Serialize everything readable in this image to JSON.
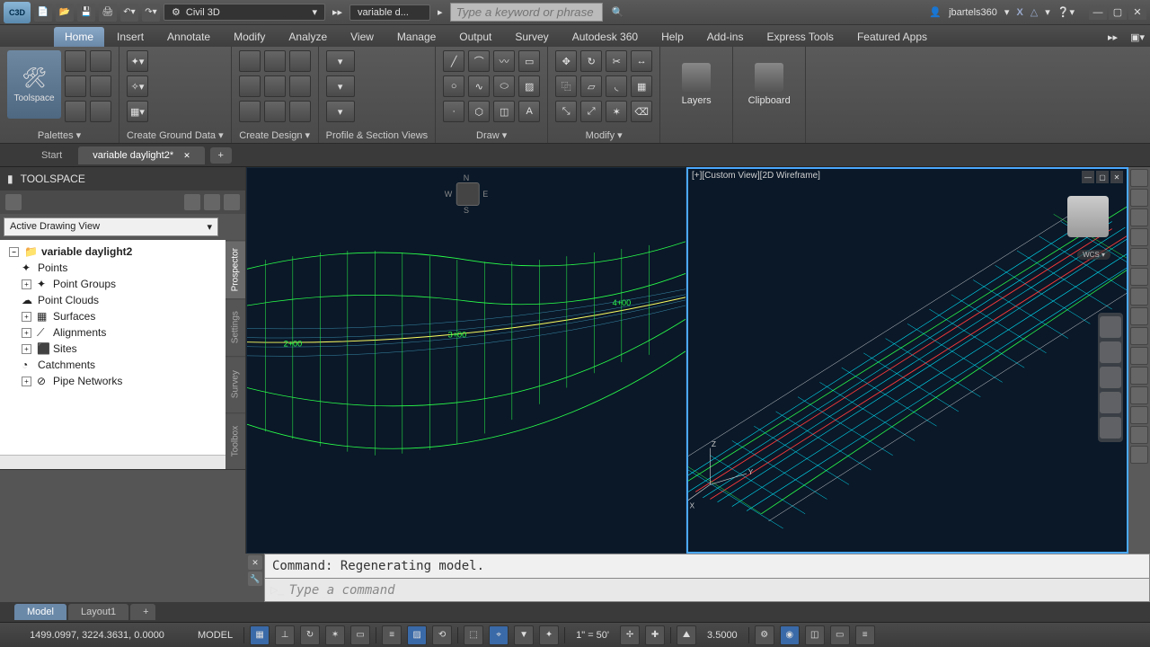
{
  "titlebar": {
    "app_abbrev": "C3D",
    "workspace": "Civil 3D",
    "doc_short": "variable d...",
    "search_placeholder": "Type a keyword or phrase",
    "username": "jbartels360"
  },
  "ribbon_tabs": [
    "Home",
    "Insert",
    "Annotate",
    "Modify",
    "Analyze",
    "View",
    "Manage",
    "Output",
    "Survey",
    "Autodesk 360",
    "Help",
    "Add-ins",
    "Express Tools",
    "Featured Apps"
  ],
  "ribbon_active": "Home",
  "ribbon_panels": {
    "palettes": "Palettes ▾",
    "toolspace_btn": "Toolspace",
    "create_ground": "Create Ground Data ▾",
    "create_design": "Create Design ▾",
    "profile_section": "Profile & Section Views",
    "draw": "Draw ▾",
    "modify": "Modify ▾",
    "layers": "Layers",
    "clipboard": "Clipboard"
  },
  "doc_tabs": {
    "start": "Start",
    "active": "variable daylight2*"
  },
  "toolspace": {
    "title": "TOOLSPACE",
    "view_selector": "Active Drawing View",
    "vtabs": [
      "Prospector",
      "Settings",
      "Survey",
      "Toolbox"
    ],
    "vtab_active": "Prospector",
    "tree_root": "variable daylight2",
    "tree_items": [
      "Points",
      "Point Groups",
      "Point Clouds",
      "Surfaces",
      "Alignments",
      "Sites",
      "Catchments",
      "Pipe Networks"
    ]
  },
  "views": {
    "right_label": "[+][Custom View][2D Wireframe]",
    "compass": {
      "n": "N",
      "s": "S",
      "e": "E",
      "w": "W"
    },
    "wcs": "WCS ▾",
    "stations_left": [
      "2+00",
      "3+00",
      "4+00"
    ]
  },
  "commandline": {
    "history": "Command:  Regenerating model.",
    "prompt_placeholder": "Type a command"
  },
  "layout_tabs": [
    "Model",
    "Layout1"
  ],
  "layout_active": "Model",
  "statusbar": {
    "coords": "1499.0997, 3224.3631, 0.0000",
    "space": "MODEL",
    "scale": "1\" = 50'",
    "elev": "3.5000"
  }
}
